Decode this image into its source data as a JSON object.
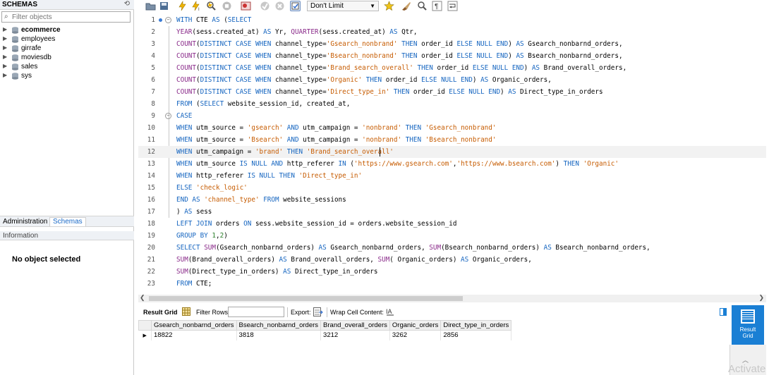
{
  "navigator": {
    "title": "SCHEMAS",
    "filter_placeholder": "Filter objects",
    "schemas": [
      "ecommerce",
      "employees",
      "girrafe",
      "moviesdb",
      "sales",
      "sys"
    ],
    "active_schema": "ecommerce",
    "tabs": [
      "Administration",
      "Schemas"
    ],
    "active_tab": "Schemas",
    "info_title": "Information",
    "info_message": "No object selected"
  },
  "toolbar": {
    "limit_value": "Don't Limit"
  },
  "editor": {
    "active_line": 12,
    "lines": [
      {
        "n": "1",
        "html": "<span class='kw'>WITH</span> CTE <span class='kw'>AS</span> (<span class='kw'>SELECT</span>"
      },
      {
        "n": "2",
        "html": "<span class='fn'>YEAR</span>(sess.created_at) <span class='kw'>AS</span> Yr, <span class='fn'>QUARTER</span>(sess.created_at) <span class='kw'>AS</span> Qtr,"
      },
      {
        "n": "3",
        "html": "<span class='fn'>COUNT</span>(<span class='kw'>DISTINCT CASE WHEN</span> channel_type=<span class='str'>'Gsearch_nonbrand'</span> <span class='kw'>THEN</span> order_id <span class='kw'>ELSE NULL END</span>) <span class='kw'>AS</span> Gsearch_nonbarnd_orders,"
      },
      {
        "n": "4",
        "html": "<span class='fn'>COUNT</span>(<span class='kw'>DISTINCT CASE WHEN</span> channel_type=<span class='str'>'Bsearch_nonbrand'</span> <span class='kw'>THEN</span> order_id <span class='kw'>ELSE NULL END</span>) <span class='kw'>AS</span> Bsearch_nonbarnd_orders,"
      },
      {
        "n": "5",
        "html": "<span class='fn'>COUNT</span>(<span class='kw'>DISTINCT CASE WHEN</span> channel_type=<span class='str'>'Brand_search_overall'</span> <span class='kw'>THEN</span> order_id <span class='kw'>ELSE NULL END</span>) <span class='kw'>AS</span> Brand_overall_orders,"
      },
      {
        "n": "6",
        "html": "<span class='fn'>COUNT</span>(<span class='kw'>DISTINCT CASE WHEN</span> channel_type=<span class='str'>'Organic'</span> <span class='kw'>THEN</span> order_id <span class='kw'>ELSE NULL END</span>) <span class='kw'>AS</span> Organic_orders,"
      },
      {
        "n": "7",
        "html": "<span class='fn'>COUNT</span>(<span class='kw'>DISTINCT CASE WHEN</span> channel_type=<span class='str'>'Direct_type_in'</span> <span class='kw'>THEN</span> order_id <span class='kw'>ELSE NULL END</span>) <span class='kw'>AS</span> Direct_type_in_orders"
      },
      {
        "n": "8",
        "html": "<span class='kw'>FROM</span> (<span class='kw'>SELECT</span> website_session_id, created_at,"
      },
      {
        "n": "9",
        "html": "<span class='kw'>CASE</span>"
      },
      {
        "n": "10",
        "html": "<span class='kw'>WHEN</span> utm_source = <span class='str'>'gsearch'</span> <span class='kw'>AND</span> utm_campaign = <span class='str'>'nonbrand'</span> <span class='kw'>THEN</span> <span class='str'>'Gsearch_nonbrand'</span>"
      },
      {
        "n": "11",
        "html": "<span class='kw'>WHEN</span> utm_source = <span class='str'>'Bsearch'</span> <span class='kw'>AND</span> utm_campaign = <span class='str'>'nonbrand'</span> <span class='kw'>THEN</span> <span class='str'>'Bsearch_nonbrand'</span>"
      },
      {
        "n": "12",
        "html": "<span class='kw'>WHEN</span> utm_campaign = <span class='str'>'brand'</span> <span class='kw'>THEN</span> <span class='str'>'Brand_search_overall'</span>"
      },
      {
        "n": "13",
        "html": "<span class='kw'>WHEN</span> utm_source <span class='kw'>IS NULL AND</span> http_referer <span class='kw'>IN</span> (<span class='str'>'https://www.gsearch.com'</span>,<span class='str'>'https://www.bsearch.com'</span>) <span class='kw'>THEN</span> <span class='str'>'Organic'</span>"
      },
      {
        "n": "14",
        "html": "<span class='kw'>WHEN</span> http_referer <span class='kw'>IS NULL THEN</span> <span class='str'>'Direct_type_in'</span>"
      },
      {
        "n": "15",
        "html": "<span class='kw'>ELSE</span> <span class='str'>'check_logic'</span>"
      },
      {
        "n": "16",
        "html": "<span class='kw'>END AS</span> <span class='str'>'channel_type'</span> <span class='kw'>FROM</span> website_sessions"
      },
      {
        "n": "17",
        "html": ") <span class='kw'>AS</span> sess"
      },
      {
        "n": "18",
        "html": "<span class='kw'>LEFT JOIN</span> orders <span class='kw'>ON</span> sess.website_session_id = orders.website_session_id"
      },
      {
        "n": "19",
        "html": "<span class='kw'>GROUP BY</span> <span class='num'>1</span>,<span class='num'>2</span>)"
      },
      {
        "n": "20",
        "html": "<span class='kw'>SELECT</span> <span class='fn'>SUM</span>(Gsearch_nonbarnd_orders) <span class='kw'>AS</span> Gsearch_nonbarnd_orders, <span class='fn'>SUM</span>(Bsearch_nonbarnd_orders) <span class='kw'>AS</span> Bsearch_nonbarnd_orders,"
      },
      {
        "n": "21",
        "html": "<span class='fn'>SUM</span>(Brand_overall_orders) <span class='kw'>AS</span> Brand_overall_orders, <span class='fn'>SUM</span>( Organic_orders) <span class='kw'>AS</span> Organic_orders,"
      },
      {
        "n": "22",
        "html": "<span class='fn'>SUM</span>(Direct_type_in_orders) <span class='kw'>AS</span> Direct_type_in_orders"
      },
      {
        "n": "23",
        "html": "<span class='kw'>FROM</span> CTE;"
      }
    ]
  },
  "result_toolbar": {
    "result_grid_label": "Result Grid",
    "filter_rows_label": "Filter Rows:",
    "export_label": "Export:",
    "wrap_label": "Wrap Cell Content:"
  },
  "result": {
    "columns": [
      "Gsearch_nonbarnd_orders",
      "Bsearch_nonbarnd_orders",
      "Brand_overall_orders",
      "Organic_orders",
      "Direct_type_in_orders"
    ],
    "rows": [
      [
        "18822",
        "3818",
        "3212",
        "3262",
        "2856"
      ]
    ]
  },
  "side": {
    "result_label_1": "Result",
    "result_label_2": "Grid",
    "watermark": "Activate"
  },
  "colors": {
    "keyword": "#1565c0",
    "string": "#c65b00",
    "function": "#8a2b8a",
    "accent": "#1a7fd4"
  }
}
